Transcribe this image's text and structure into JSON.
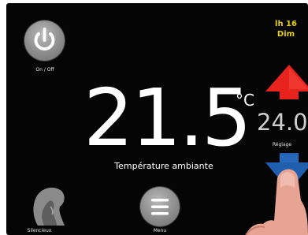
{
  "clock": {
    "time": "lh 16",
    "day": "Dim"
  },
  "power": {
    "label": "On / Off",
    "icon": "power-icon"
  },
  "temperature": {
    "value": "21.5",
    "unit": "°C",
    "label": "Température ambiante"
  },
  "setpoint": {
    "value": "24.0",
    "unit": "°",
    "label": "Réglage",
    "up_icon": "arrow-up-icon",
    "down_icon": "arrow-down-icon"
  },
  "silence": {
    "label": "Silencieux",
    "icon": "silence-face-icon"
  },
  "menu": {
    "label": "Menu",
    "icon": "menu-icon"
  },
  "colors": {
    "accent_clock": "#e6d000",
    "arrow_up": "#e8231d",
    "arrow_down": "#1f5fae",
    "screen_bg": "#050505"
  }
}
